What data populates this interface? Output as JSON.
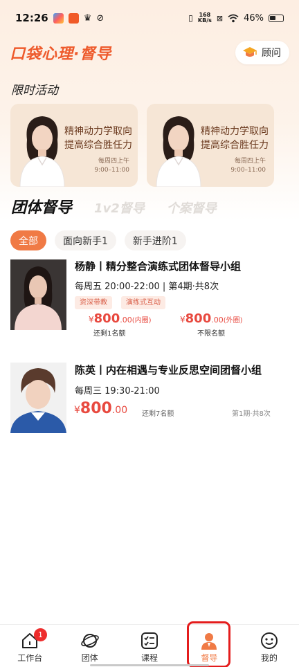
{
  "status_bar": {
    "time": "12:26",
    "net_speed_top": "168",
    "net_speed_bottom": "KB/s",
    "battery": "46%"
  },
  "header": {
    "logo": "口袋心理·督导",
    "advisor_button": "顾问"
  },
  "limited_section": {
    "title": "限时活动",
    "cards": [
      {
        "line1": "精神动力学取向",
        "line2": "提高综合胜任力",
        "sched1": "每周四上午",
        "sched2": "9:00–11:00"
      },
      {
        "line1": "精神动力学取向",
        "line2": "提高综合胜任力",
        "sched1": "每周四上午",
        "sched2": "9:00–11:00"
      }
    ]
  },
  "tabs": [
    "团体督导",
    "1v2督导",
    "个案督导"
  ],
  "filters": [
    "全部",
    "面向新手1",
    "新手进阶1"
  ],
  "groups": [
    {
      "title": "杨静丨精分整合演练式团体督导小组",
      "schedule": "每周五 20:00-22:00 | 第4期·共8次",
      "tags": [
        "资深带教",
        "演练式互动"
      ],
      "prices": [
        {
          "currency": "¥",
          "amount": "800",
          "decimal": ".00",
          "label": "(内圈)",
          "note": "还剩1名额"
        },
        {
          "currency": "¥",
          "amount": "800",
          "decimal": ".00",
          "label": "(外圈)",
          "note": "不限名额"
        }
      ]
    },
    {
      "title": "陈英丨内在相遇与专业反思空间团督小组",
      "schedule": "每周三 19:30-21:00",
      "price": {
        "currency": "¥",
        "amount": "800",
        "decimal": ".00"
      },
      "remaining": "还剩7名额",
      "session": "第1期·共8次"
    }
  ],
  "tabbar": [
    {
      "label": "工作台",
      "icon": "house-icon",
      "badge": "1"
    },
    {
      "label": "团体",
      "icon": "planet-icon"
    },
    {
      "label": "课程",
      "icon": "checklist-icon"
    },
    {
      "label": "督导",
      "icon": "person-icon",
      "active": true
    },
    {
      "label": "我的",
      "icon": "smiley-icon"
    }
  ],
  "colors": {
    "accent": "#f07a45",
    "price": "#e8493f",
    "brand": "#ee5a2c"
  }
}
